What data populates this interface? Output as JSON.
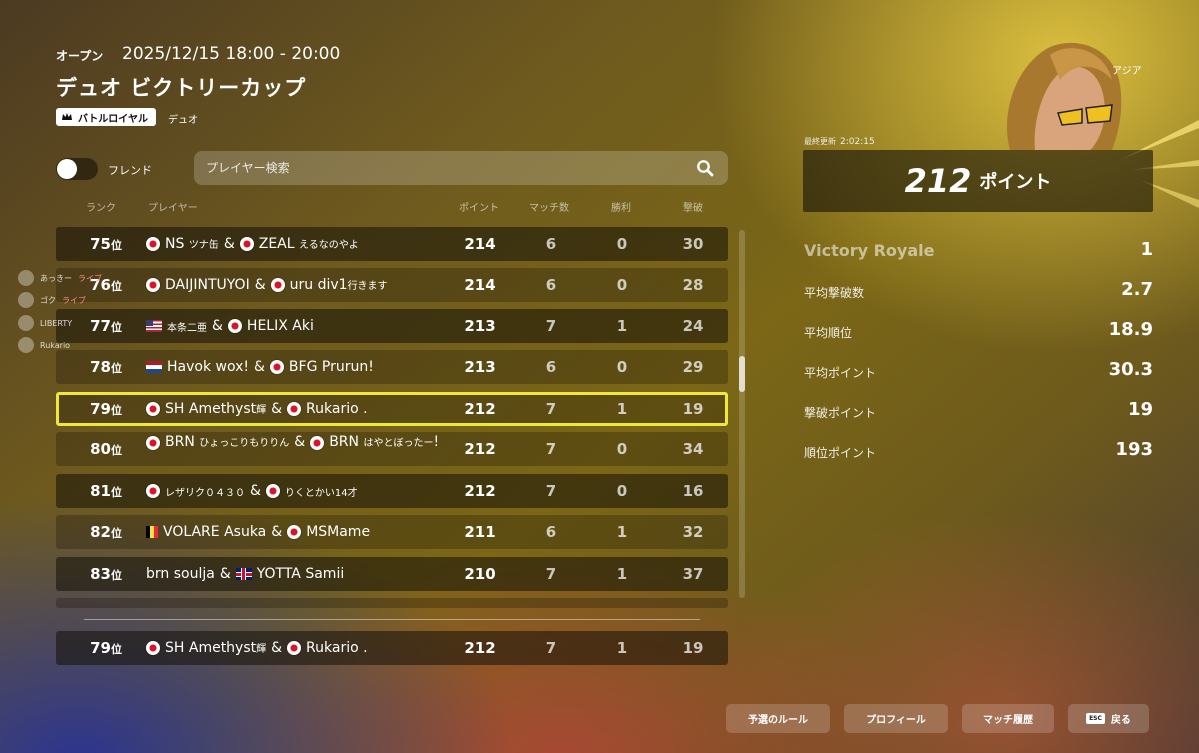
{
  "header": {
    "open_label": "オープン",
    "date": "2025/12/15 18:00 - 20:00",
    "title": "デュオ ビクトリーカップ",
    "mode_badge": "バトルロイヤル",
    "mode_sub": "デュオ"
  },
  "controls": {
    "friend_label": "フレンド",
    "search_placeholder": "プレイヤー検索"
  },
  "columns": {
    "rank": "ランク",
    "player": "プレイヤー",
    "points": "ポイント",
    "matches": "マッチ数",
    "wins": "勝利",
    "kills": "撃破"
  },
  "rows": [
    {
      "rank": "75",
      "p1": "NS ツナ缶",
      "p2": "ZEAL えるなのやよ",
      "points": "214",
      "matches": "6",
      "wins": "0",
      "kills": "30"
    },
    {
      "rank": "76",
      "p1": "DAIJINTUYOI",
      "p2": "uru div1行きます",
      "points": "214",
      "matches": "6",
      "wins": "0",
      "kills": "28"
    },
    {
      "rank": "77",
      "p1": "本条二亜",
      "p2": "HELIX Aki",
      "points": "213",
      "matches": "7",
      "wins": "1",
      "kills": "24"
    },
    {
      "rank": "78",
      "p1": "Havok wox!",
      "p2": "BFG Prurun!",
      "points": "213",
      "matches": "6",
      "wins": "0",
      "kills": "29"
    },
    {
      "rank": "79",
      "p1": "SH Amethyst輝",
      "p2": "Rukario .",
      "points": "212",
      "matches": "7",
      "wins": "1",
      "kills": "19"
    },
    {
      "rank": "80",
      "p1": "BRN ひょっこりもりりん",
      "p2": "BRN はやとぼったー!",
      "points": "212",
      "matches": "7",
      "wins": "0",
      "kills": "34"
    },
    {
      "rank": "81",
      "p1": "レザリク０４３０",
      "p2": "りくとかい14才",
      "points": "212",
      "matches": "7",
      "wins": "0",
      "kills": "16"
    },
    {
      "rank": "82",
      "p1": "VOLARE Asuka",
      "p2": "MSMame",
      "points": "211",
      "matches": "6",
      "wins": "1",
      "kills": "32"
    },
    {
      "rank": "83",
      "p1": "brn soulja",
      "p2": "YOTTA Samii",
      "points": "210",
      "matches": "7",
      "wins": "1",
      "kills": "37"
    }
  ],
  "rank_suffix": "位",
  "amp": "&",
  "my_row": {
    "rank": "79",
    "p1": "SH Amethyst輝",
    "p2": "Rukario .",
    "points": "212",
    "matches": "7",
    "wins": "1",
    "kills": "19"
  },
  "overlay": [
    {
      "name": "あっきー",
      "live": "ライブ"
    },
    {
      "name": "ゴク",
      "live": "ライブ"
    },
    {
      "name": "LIBERTY",
      "live": ""
    },
    {
      "name": "Rukario",
      "live": ""
    }
  ],
  "panel": {
    "region": "アジア",
    "updated_label": "最終更新",
    "updated_time": "2:02:15",
    "total_points": "212",
    "points_unit": "ポイント",
    "stats": [
      {
        "label": "Victory Royale",
        "value": "1"
      },
      {
        "label": "平均撃破数",
        "value": "2.7"
      },
      {
        "label": "平均順位",
        "value": "18.9"
      },
      {
        "label": "平均ポイント",
        "value": "30.3"
      },
      {
        "label": "撃破ポイント",
        "value": "19"
      },
      {
        "label": "順位ポイント",
        "value": "193"
      }
    ]
  },
  "buttons": {
    "rules": "予選のルール",
    "profile": "プロフィール",
    "history": "マッチ履歴",
    "esc_key": "ESC",
    "back": "戻る"
  },
  "colors": {
    "highlight": "#ede83a",
    "accent_yellow": "#ecce46"
  }
}
